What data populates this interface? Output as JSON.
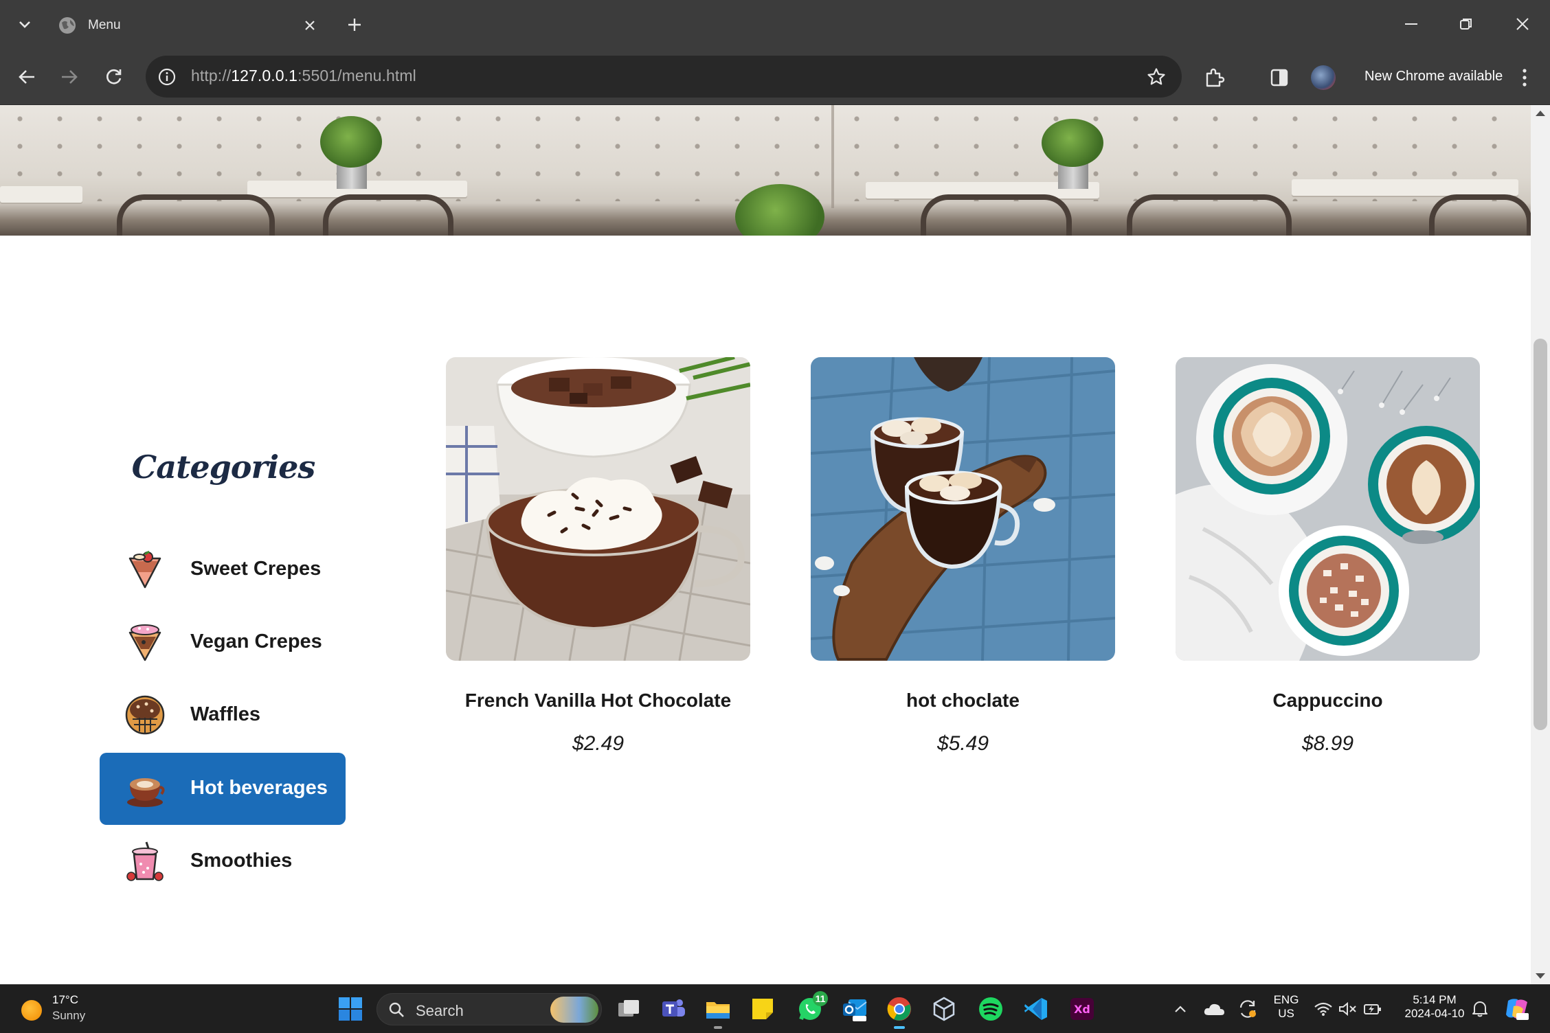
{
  "browser": {
    "tab_title": "Menu",
    "url_scheme": "http://",
    "url_host": "127.0.0.1",
    "url_rest": ":5501/menu.html",
    "update_label": "New Chrome available"
  },
  "sidebar": {
    "title": "Categories",
    "items": [
      {
        "label": "Sweet Crepes",
        "icon": "crepe-icon",
        "active": false
      },
      {
        "label": "Vegan Crepes",
        "icon": "vegan-crepe-icon",
        "active": false
      },
      {
        "label": "Waffles",
        "icon": "waffle-icon",
        "active": false
      },
      {
        "label": "Hot beverages",
        "icon": "hot-beverage-icon",
        "active": true
      },
      {
        "label": "Smoothies",
        "icon": "smoothie-icon",
        "active": false
      }
    ],
    "active_color": "#1b6cb8"
  },
  "products": [
    {
      "name": "French Vanilla Hot Chocolate",
      "price": "$2.49",
      "image": "hot-chocolate-whipped-cream-image"
    },
    {
      "name": "hot choclate",
      "price": "$5.49",
      "image": "hot-chocolate-marshmallow-image"
    },
    {
      "name": "Cappuccino",
      "price": "$8.99",
      "image": "cappuccino-cups-image"
    }
  ],
  "taskbar": {
    "weather_temp": "17°C",
    "weather_cond": "Sunny",
    "search_label": "Search",
    "whatsapp_badge": "11",
    "lang_top": "ENG",
    "lang_bottom": "US",
    "time": "5:14 PM",
    "date": "2024-04-10"
  }
}
